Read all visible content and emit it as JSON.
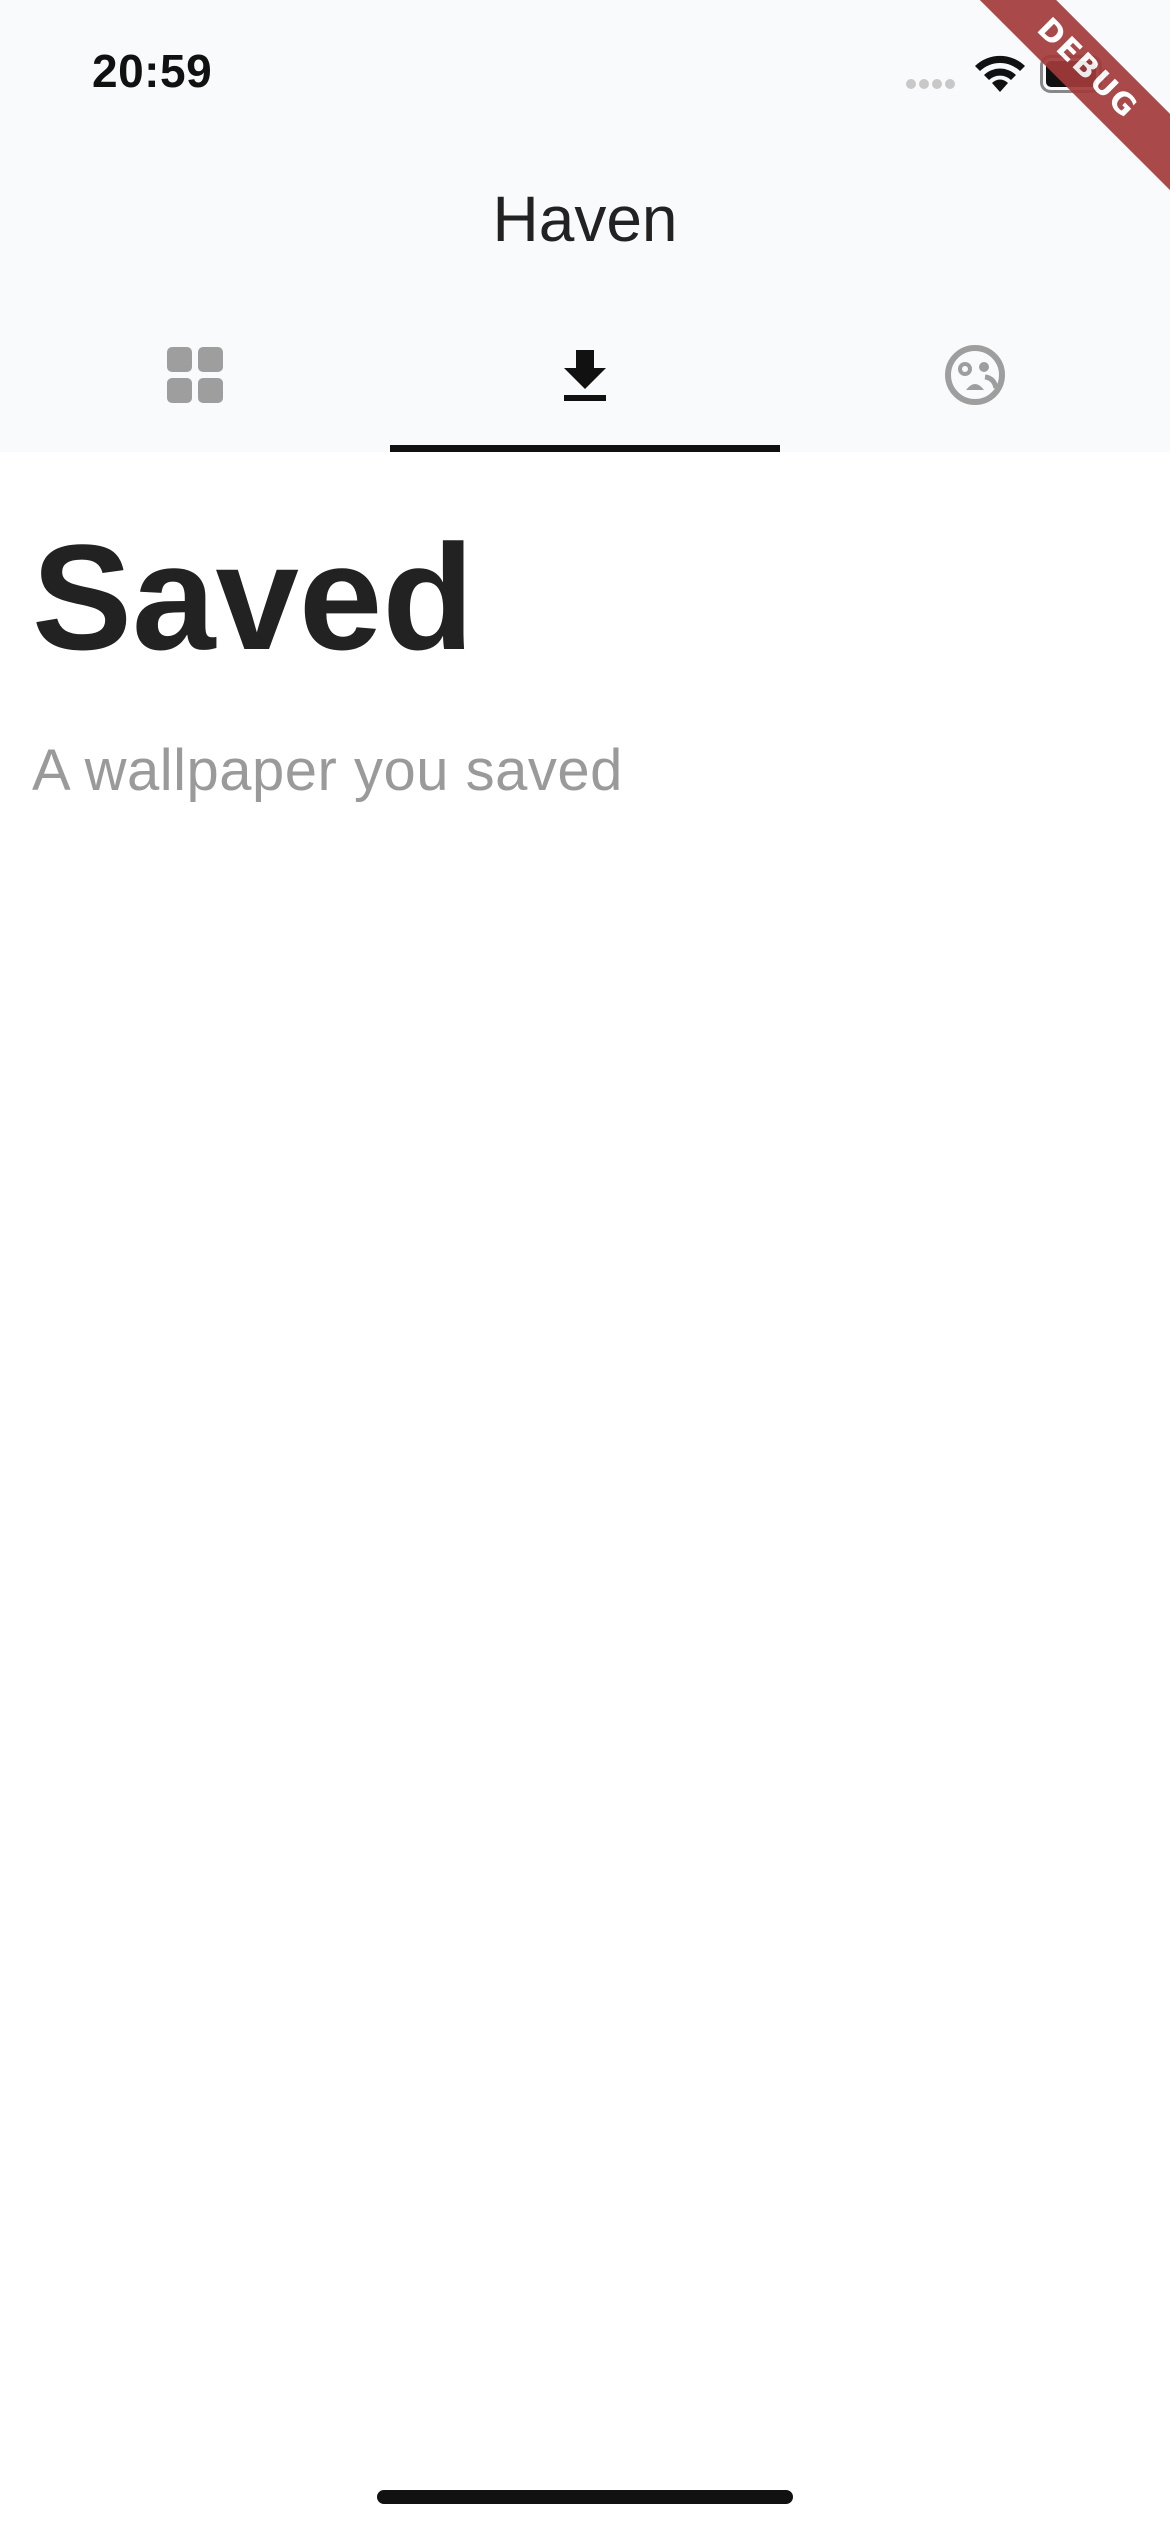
{
  "status_bar": {
    "time": "20:59"
  },
  "app_bar": {
    "title": "Haven"
  },
  "tabs": [
    {
      "icon": "grid-icon",
      "selected": false
    },
    {
      "icon": "download-icon",
      "selected": true
    },
    {
      "icon": "face-icon",
      "selected": false
    }
  ],
  "debug_banner": "DEBUG",
  "page": {
    "title": "Saved",
    "subtitle": "A wallpaper you saved"
  },
  "colors": {
    "top_background": "#f9fafc",
    "selected_icon": "#111111",
    "unselected_icon": "#9e9e9e",
    "indicator": "#111111",
    "subtitle": "#9a9a9a",
    "debug_ribbon": "#a33a3a"
  }
}
